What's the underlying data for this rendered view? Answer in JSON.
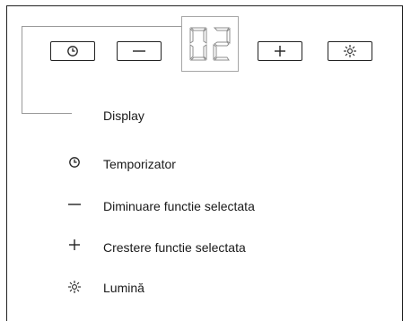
{
  "panel": {
    "display_value": "02",
    "buttons": [
      {
        "id": "timer",
        "icon": "clock-icon"
      },
      {
        "id": "minus",
        "icon": "minus-icon"
      },
      {
        "id": "plus",
        "icon": "plus-icon"
      },
      {
        "id": "light",
        "icon": "light-icon"
      }
    ]
  },
  "legend": {
    "display_label": "Display",
    "items": [
      {
        "icon": "clock-icon",
        "label": "Temporizator"
      },
      {
        "icon": "minus-icon",
        "label": "Diminuare functie selectata"
      },
      {
        "icon": "plus-icon",
        "label": "Crestere functie selectata"
      },
      {
        "icon": "light-icon",
        "label": "Lumină"
      }
    ]
  }
}
